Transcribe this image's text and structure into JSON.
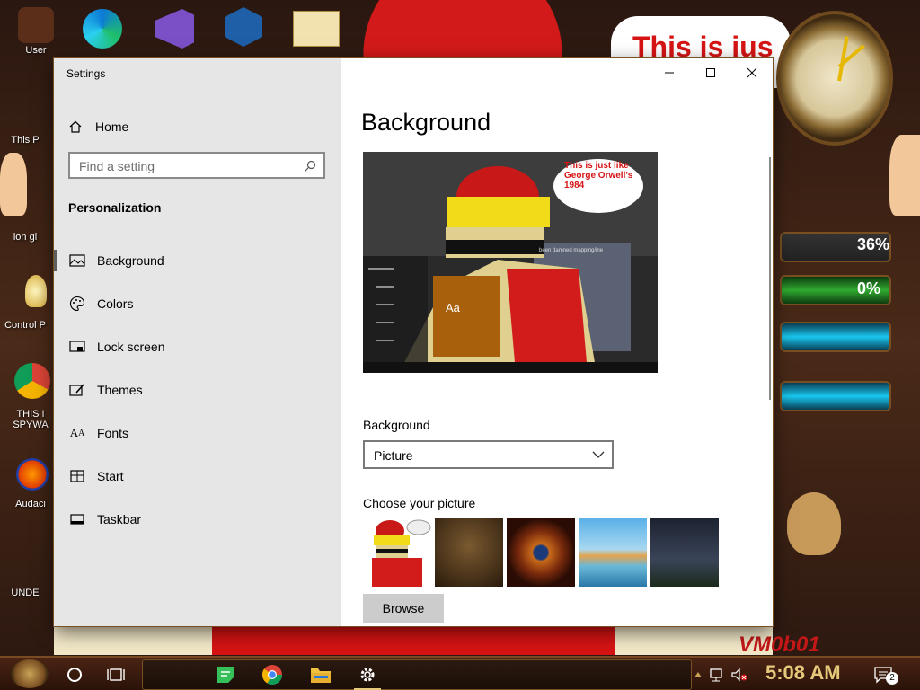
{
  "desktop": {
    "icons": [
      {
        "label": "User"
      },
      {
        "label": "This P"
      },
      {
        "label": "ion gi"
      },
      {
        "label": "Control P"
      },
      {
        "label": "THIS I SPYWA"
      },
      {
        "label": "Audaci"
      },
      {
        "label": "UNDE"
      }
    ],
    "banner_text": "This is jus",
    "watermark": "VM0b01",
    "gauges": {
      "value1": "36%",
      "value2": "0%"
    }
  },
  "window": {
    "app_title": "Settings",
    "controls": {
      "minimize": "─",
      "maximize": "☐",
      "close": "✕"
    },
    "sidebar": {
      "home_label": "Home",
      "search_placeholder": "Find a setting",
      "section_title": "Personalization",
      "items": [
        {
          "label": "Background",
          "icon": "picture-icon",
          "selected": true
        },
        {
          "label": "Colors",
          "icon": "palette-icon"
        },
        {
          "label": "Lock screen",
          "icon": "lock-screen-icon"
        },
        {
          "label": "Themes",
          "icon": "themes-icon"
        },
        {
          "label": "Fonts",
          "icon": "fonts-icon"
        },
        {
          "label": "Start",
          "icon": "start-icon"
        },
        {
          "label": "Taskbar",
          "icon": "taskbar-icon"
        }
      ]
    },
    "main": {
      "title": "Background",
      "preview": {
        "speech_text": "This is just like George Orwell's 1984",
        "sample_text": "Aa",
        "window_caption": "been damned mapping/ine"
      },
      "background_label": "Background",
      "background_value": "Picture",
      "choose_label": "Choose your picture",
      "browse_label": "Browse"
    }
  },
  "taskbar": {
    "time": "5:08 AM",
    "notification_count": "2"
  },
  "colors": {
    "sidebar_bg": "#e6e6e6",
    "accent_red": "#d61414",
    "taskbar_bg": "#3a1a0c"
  }
}
